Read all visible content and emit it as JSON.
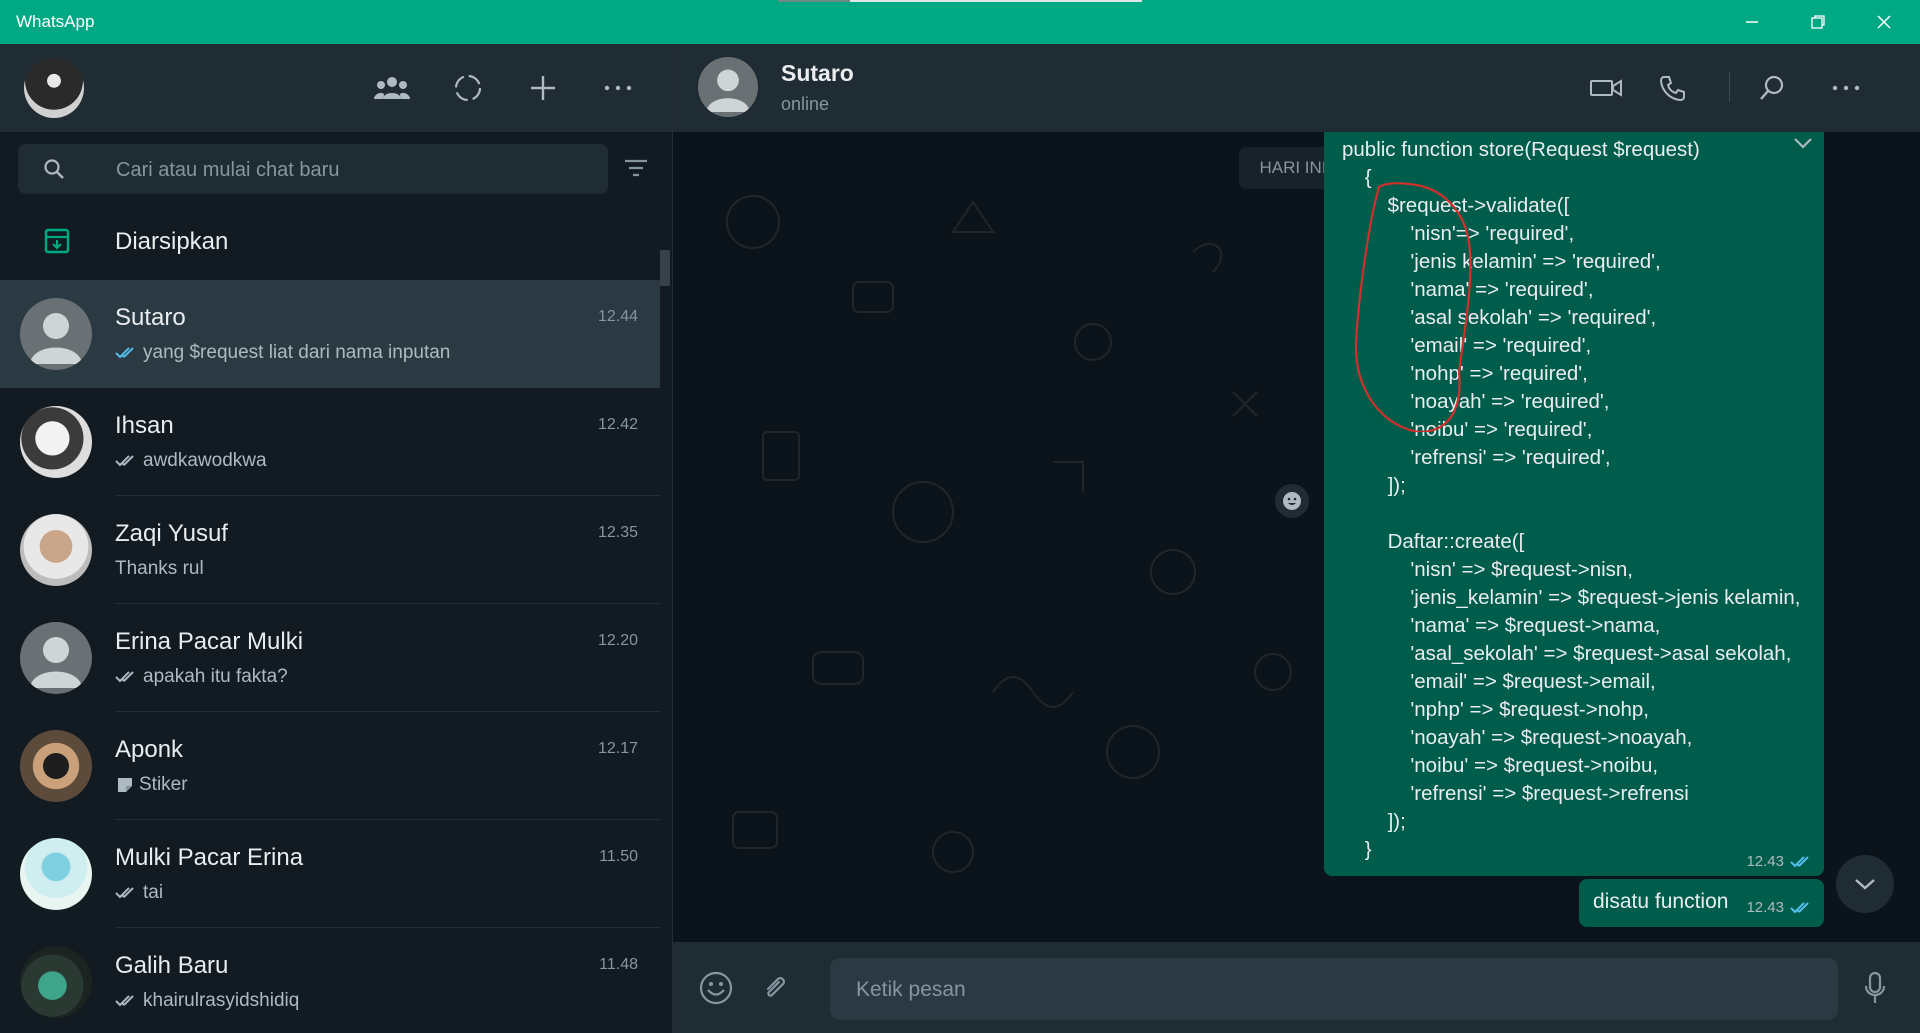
{
  "window": {
    "title": "WhatsApp",
    "minimize_icon": "minimize-icon",
    "maximize_icon": "restore-icon",
    "close_icon": "close-icon"
  },
  "sidebar": {
    "header_icons": [
      "community-icon",
      "status-icon",
      "new-chat-icon",
      "menu-icon"
    ],
    "search": {
      "placeholder": "Cari atau mulai chat baru",
      "value": ""
    },
    "archived": {
      "label": "Diarsipkan"
    },
    "chats": [
      {
        "name": "Sutaro",
        "time": "12.44",
        "preview": "yang $request liat dari nama inputan",
        "tick": "blue",
        "active": true
      },
      {
        "name": "Ihsan",
        "time": "12.42",
        "preview": "awdkawodkwa",
        "tick": "grey"
      },
      {
        "name": "Zaqi Yusuf",
        "time": "12.35",
        "preview": "Thanks rul",
        "tick": "none"
      },
      {
        "name": "Erina Pacar Mulki",
        "time": "12.20",
        "preview": "apakah itu fakta?",
        "tick": "grey"
      },
      {
        "name": "Aponk",
        "time": "12.17",
        "preview": "Stiker",
        "tick": "sticker"
      },
      {
        "name": "Mulki Pacar Erina",
        "time": "11.50",
        "preview": "tai",
        "tick": "grey"
      },
      {
        "name": "Galih Baru",
        "time": "11.48",
        "preview": "khairulrasyidshidiq",
        "tick": "grey"
      }
    ]
  },
  "conversation": {
    "contact_name": "Sutaro",
    "contact_status": "online",
    "date_chip": "HARI INI",
    "code_message": {
      "lines": [
        "public function store(Request $request)",
        "    {",
        "        $request->validate([",
        "            'nisn'=> 'required',",
        "            'jenis kelamin' => 'required',",
        "            'nama' => 'required',",
        "            'asal sekolah' => 'required',",
        "            'email' => 'required',",
        "            'nohp' => 'required',",
        "            'noayah' => 'required',",
        "            'noibu' => 'required',",
        "            'refrensi' => 'required',",
        "        ]);",
        "",
        "        Daftar::create([",
        "            'nisn' => $request->nisn,",
        "            'jenis_kelamin' => $request->jenis kelamin,",
        "            'nama' => $request->nama,",
        "            'asal_sekolah' => $request->asal sekolah,",
        "            'email' => $request->email,",
        "            'nphp' => $request->nohp,",
        "            'noayah' => $request->noayah,",
        "            'noibu' => $request->noibu,",
        "            'refrensi' => $request->refrensi",
        "        ]);",
        "    }"
      ],
      "time": "12.43",
      "status": "read"
    },
    "short_message": {
      "text": "disatu function",
      "time": "12.43",
      "status": "read"
    }
  },
  "composer": {
    "placeholder": "Ketik pesan",
    "value": ""
  },
  "colors": {
    "accent": "#00a884",
    "bubble_out": "#005c4b",
    "read_tick": "#53bdeb",
    "panel": "#202c33",
    "background": "#0b141a",
    "annotation": "#d0312d"
  }
}
